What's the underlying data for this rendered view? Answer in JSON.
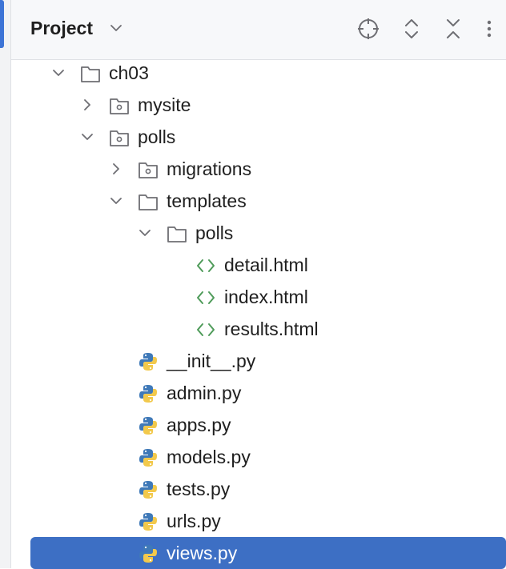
{
  "header": {
    "title": "Project"
  },
  "tree": {
    "items": [
      {
        "label": "ch03",
        "type": "folder",
        "expanded": true
      },
      {
        "label": "mysite",
        "type": "package",
        "expanded": false
      },
      {
        "label": "polls",
        "type": "package",
        "expanded": true
      },
      {
        "label": "migrations",
        "type": "package",
        "expanded": false
      },
      {
        "label": "templates",
        "type": "folder",
        "expanded": true
      },
      {
        "label": "polls",
        "type": "folder",
        "expanded": true
      },
      {
        "label": "detail.html",
        "type": "html"
      },
      {
        "label": "index.html",
        "type": "html"
      },
      {
        "label": "results.html",
        "type": "html"
      },
      {
        "label": "__init__.py",
        "type": "python"
      },
      {
        "label": "admin.py",
        "type": "python"
      },
      {
        "label": "apps.py",
        "type": "python"
      },
      {
        "label": "models.py",
        "type": "python"
      },
      {
        "label": "tests.py",
        "type": "python"
      },
      {
        "label": "urls.py",
        "type": "python"
      },
      {
        "label": "views.py",
        "type": "python",
        "selected": true
      }
    ]
  },
  "colors": {
    "selection": "#3d6fc4",
    "accent": "#3d74d6",
    "html_icon": "#4f9b5a",
    "python_blue": "#3f79b8",
    "python_yellow": "#f2c94c"
  }
}
